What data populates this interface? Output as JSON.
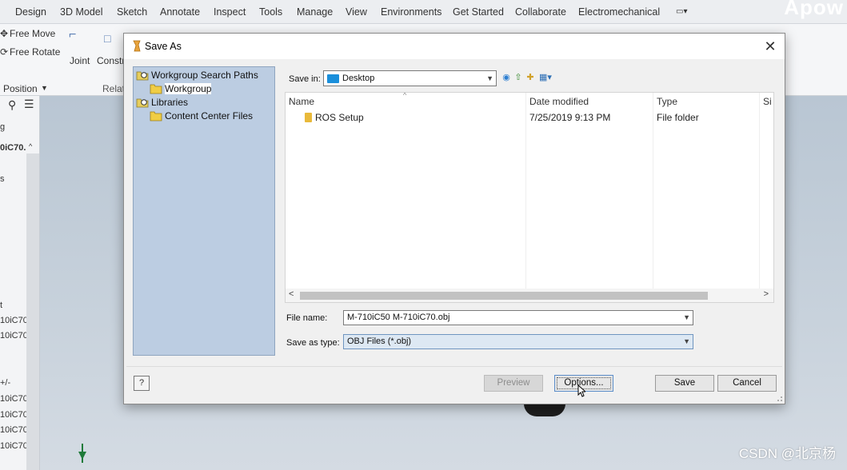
{
  "app": {
    "ribbon_tabs": [
      "Design",
      "3D Model",
      "Sketch",
      "Annotate",
      "Inspect",
      "Tools",
      "Manage",
      "View",
      "Environments",
      "Get Started",
      "Collaborate",
      "Electromechanical"
    ],
    "ribbon": {
      "free_move": "Free Move",
      "free_rotate": "Free Rotate",
      "position": "Position",
      "joint": "Joint",
      "constrain": "Constr",
      "relationships": "Relati"
    },
    "watermark_top": "Apow",
    "browser_items": [
      "g",
      "0iC70.",
      "s",
      "t",
      "10iC70",
      "10iC70",
      "+/-",
      "10iC70",
      "10iC70",
      "10iC70",
      "10iC70"
    ],
    "footer_watermark": "CSDN @北京杨"
  },
  "dialog": {
    "title": "Save As",
    "close_label": "✕",
    "places": [
      {
        "label": "Workgroup Search Paths",
        "icon": "search-paths-icon"
      },
      {
        "label": "Workgroup",
        "icon": "folder-icon"
      },
      {
        "label": "Libraries",
        "icon": "libraries-icon"
      },
      {
        "label": "Content Center Files",
        "icon": "folder-icon"
      }
    ],
    "save_in": {
      "label": "Save in:",
      "value": "Desktop"
    },
    "nav_icons": [
      "back-icon",
      "up-folder-icon",
      "new-folder-icon",
      "view-menu-icon"
    ],
    "columns": [
      "Name",
      "Date modified",
      "Type",
      "Si"
    ],
    "files": [
      {
        "name": "ROS Setup",
        "date": "7/25/2019 9:13 PM",
        "type": "File folder"
      }
    ],
    "file_name": {
      "label": "File name:",
      "value": "M-710iC50 M-710iC70.obj"
    },
    "save_as_type": {
      "label": "Save as type:",
      "value": "OBJ Files (*.obj)"
    },
    "help_label": "?",
    "buttons": {
      "preview": "Preview",
      "options": "Options...",
      "save": "Save",
      "cancel": "Cancel"
    }
  },
  "colors": {
    "places_bg": "#bccde2",
    "folder_blue": "#1a8fdb",
    "folder_yellow": "#e9b93a"
  }
}
